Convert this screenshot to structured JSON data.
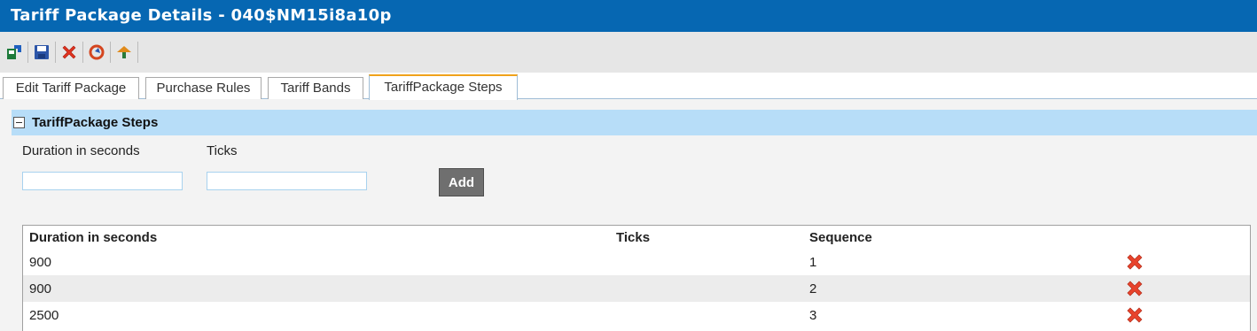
{
  "window": {
    "title": "Tariff Package Details - 040$NM15i8a10p"
  },
  "toolbar": {
    "buttons": [
      {
        "name": "save-and-close-icon"
      },
      {
        "name": "save-icon"
      },
      {
        "name": "delete-icon"
      },
      {
        "name": "refresh-icon"
      },
      {
        "name": "navigate-up-icon"
      }
    ]
  },
  "tabs": [
    {
      "label": "Edit Tariff Package",
      "active": false
    },
    {
      "label": "Purchase Rules",
      "active": false
    },
    {
      "label": "Tariff Bands",
      "active": false
    },
    {
      "label": "TariffPackage Steps",
      "active": true
    }
  ],
  "section": {
    "title": "TariffPackage Steps",
    "form": {
      "duration_label": "Duration in seconds",
      "duration_value": "",
      "ticks_label": "Ticks",
      "ticks_value": "",
      "add_label": "Add"
    },
    "table": {
      "columns": [
        "Duration in seconds",
        "Ticks",
        "Sequence"
      ],
      "rows": [
        {
          "duration": "900",
          "ticks": "",
          "sequence": "1"
        },
        {
          "duration": "900",
          "ticks": "",
          "sequence": "2"
        },
        {
          "duration": "2500",
          "ticks": "",
          "sequence": "3"
        }
      ]
    }
  },
  "colors": {
    "title_bar": "#0667b2",
    "section_header": "#b7ddf8",
    "active_tab_accent": "#f0a21a",
    "delete_icon": "#e8432c"
  }
}
